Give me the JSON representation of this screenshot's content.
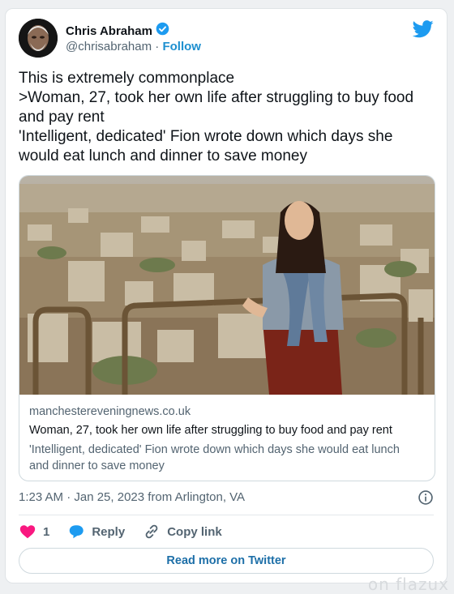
{
  "author": {
    "name": "Chris Abraham",
    "handle": "@chrisabraham",
    "separator": "·",
    "follow_label": "Follow",
    "avatar_icon": "avatar-photo",
    "verified_icon": "verified-badge-icon"
  },
  "brand": {
    "icon": "twitter-bird-icon",
    "color": "#1d9bf0"
  },
  "tweet": {
    "lines": [
      "This is extremely commonplace",
      ">Woman, 27, took her own life after struggling to buy food",
      "and pay rent",
      "'Intelligent, dedicated' Fion wrote down which days she",
      "would eat lunch and dinner to save money"
    ]
  },
  "link_card": {
    "domain": "manchestereveningnews.co.uk",
    "title": "Woman, 27, took her own life after struggling to buy food and pay rent",
    "description_lines": [
      "'Intelligent, dedicated' Fion wrote down which days she would eat lunch",
      "and dinner to save money"
    ]
  },
  "meta": {
    "timestamp": "1:23 AM · Jan 25, 2023 from Arlington, VA"
  },
  "actions": {
    "like_count": "1",
    "reply_label": "Reply",
    "copy_label": "Copy link"
  },
  "read_more_label": "Read more on Twitter",
  "watermark": "on flazux",
  "colors": {
    "like": "#f91880",
    "reply": "#1d9bf0",
    "link": "#1d6fa8",
    "muted": "#536471"
  }
}
